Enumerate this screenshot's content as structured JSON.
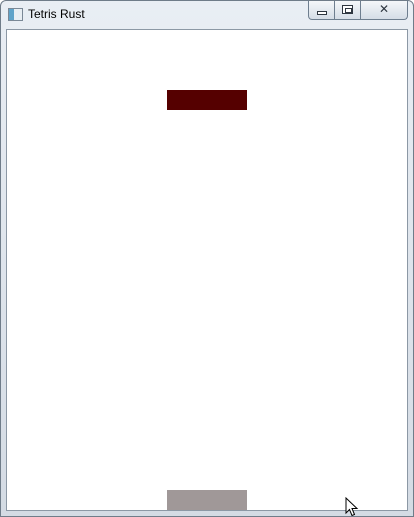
{
  "window": {
    "title": "Tetris Rust",
    "icon": "app-window-icon",
    "controls": {
      "minimize_icon": "minimize-icon",
      "maximize_icon": "maximize-icon",
      "close_glyph": "✕"
    }
  },
  "game": {
    "active_piece": {
      "shape": "I",
      "orientation": "horizontal",
      "color": "#550000"
    },
    "ghost_piece": {
      "shape": "I",
      "orientation": "horizontal",
      "color": "#a09898"
    }
  },
  "colors": {
    "board_background": "#ffffff",
    "window_frame": "#d4dbe4"
  }
}
